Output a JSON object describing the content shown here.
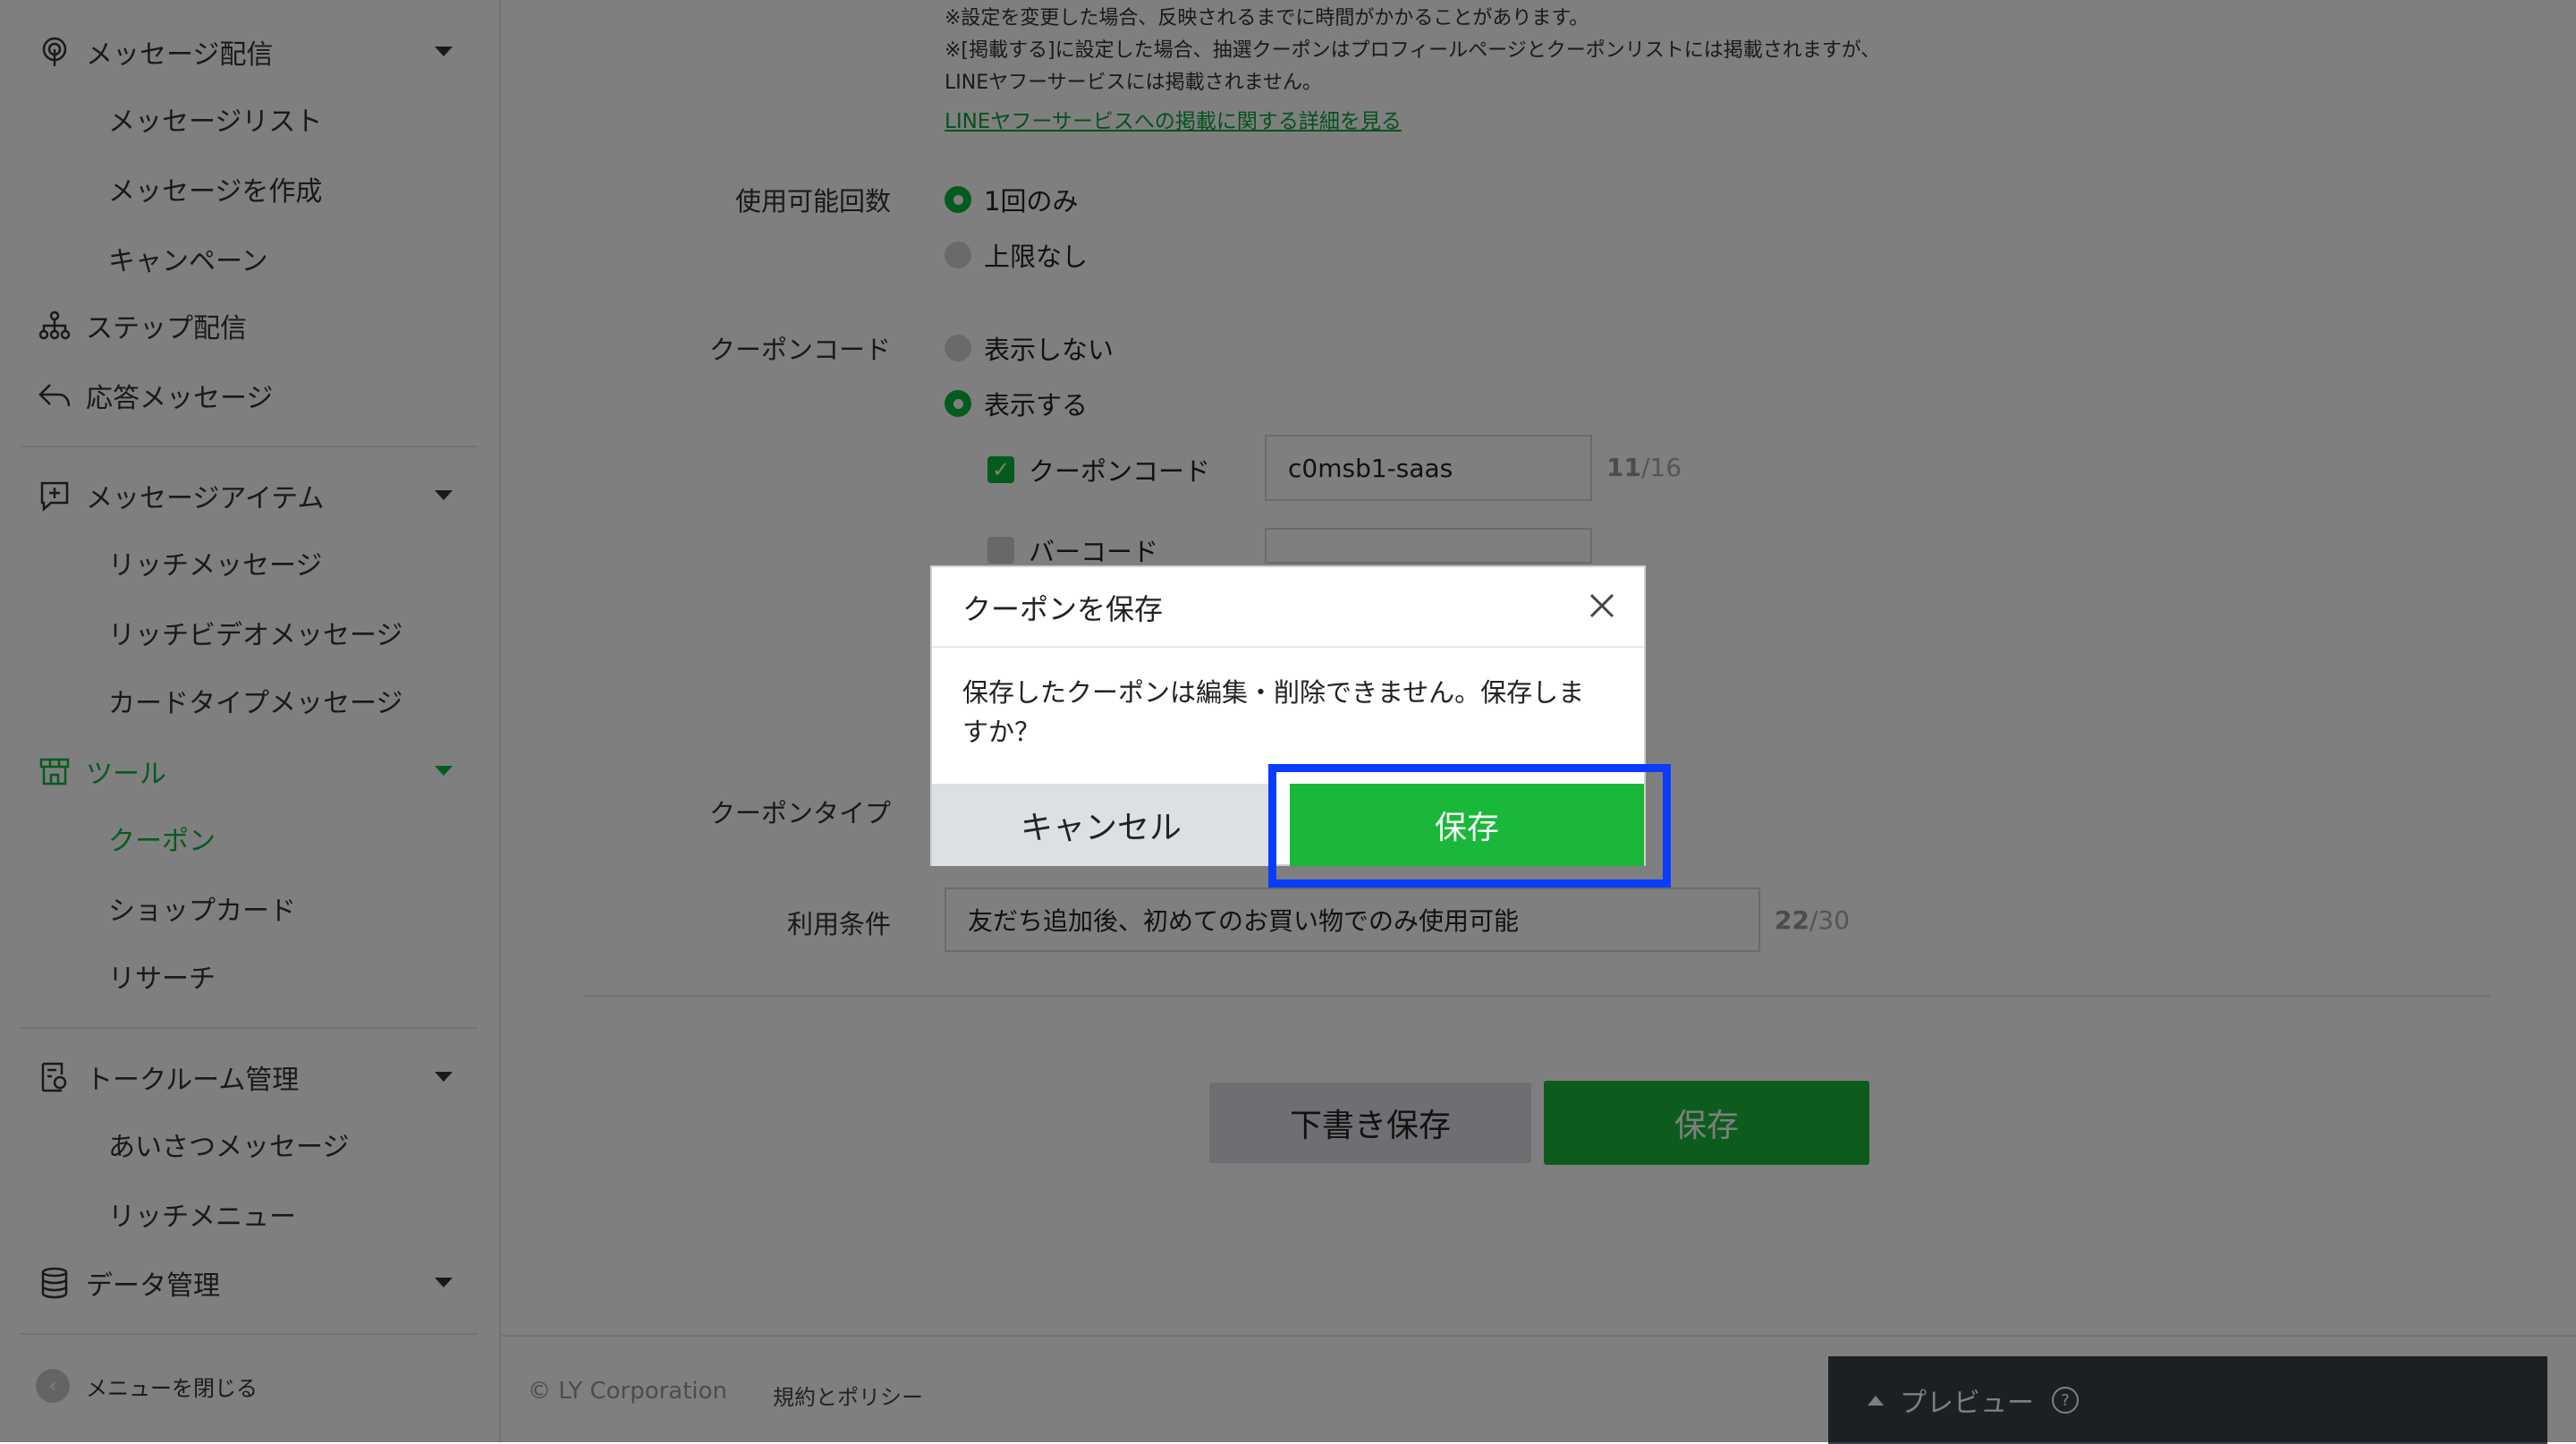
{
  "sidebar": {
    "message_delivery": "メッセージ配信",
    "message_list": "メッセージリスト",
    "create_message": "メッセージを作成",
    "campaign": "キャンペーン",
    "step_delivery": "ステップ配信",
    "auto_reply": "応答メッセージ",
    "message_items": "メッセージアイテム",
    "rich_message": "リッチメッセージ",
    "rich_video_message": "リッチビデオメッセージ",
    "card_type_message": "カードタイプメッセージ",
    "tools": "ツール",
    "coupon": "クーポン",
    "shop_card": "ショップカード",
    "research": "リサーチ",
    "talk_room": "トークルーム管理",
    "greeting_message": "あいさつメッセージ",
    "rich_menu": "リッチメニュー",
    "data_management": "データ管理",
    "close_menu": "メニューを閉じる"
  },
  "form": {
    "note1": "※設定を変更した場合、反映されるまでに時間がかかることがあります。",
    "note2": "※[掲載する]に設定した場合、抽選クーポンはプロフィールページとクーポンリストには掲載されますが、",
    "note3": "LINEヤフーサービスには掲載されません。",
    "detail_link": "LINEヤフーサービスへの掲載に関する詳細を見る",
    "usage_label": "使用可能回数",
    "usage_once": "1回のみ",
    "usage_unlimited": "上限なし",
    "code_label": "クーポンコード",
    "code_hide": "表示しない",
    "code_show": "表示する",
    "code_checkbox": "クーポンコード",
    "code_value": "c0msb1-saas",
    "code_count": "11",
    "code_max": "/16",
    "barcode_checkbox": "バーコード",
    "type_label": "クーポンタイプ",
    "terms_label": "利用条件",
    "terms_value": "友だち追加後、初めてのお買い物でのみ使用可能",
    "terms_count": "22",
    "terms_max": "/30",
    "draft_button": "下書き保存",
    "save_button": "保存"
  },
  "footer": {
    "copyright": "© LY Corporation",
    "policy": "規約とポリシー",
    "preview": "プレビュー",
    "help": "?"
  },
  "modal": {
    "title": "クーポンを保存",
    "message": "保存したクーポンは編集・削除できません。保存しますか？",
    "cancel": "キャンセル",
    "save": "保存"
  },
  "colors": {
    "accent_green": "#06b83a",
    "highlight_blue": "#0a3cff"
  }
}
